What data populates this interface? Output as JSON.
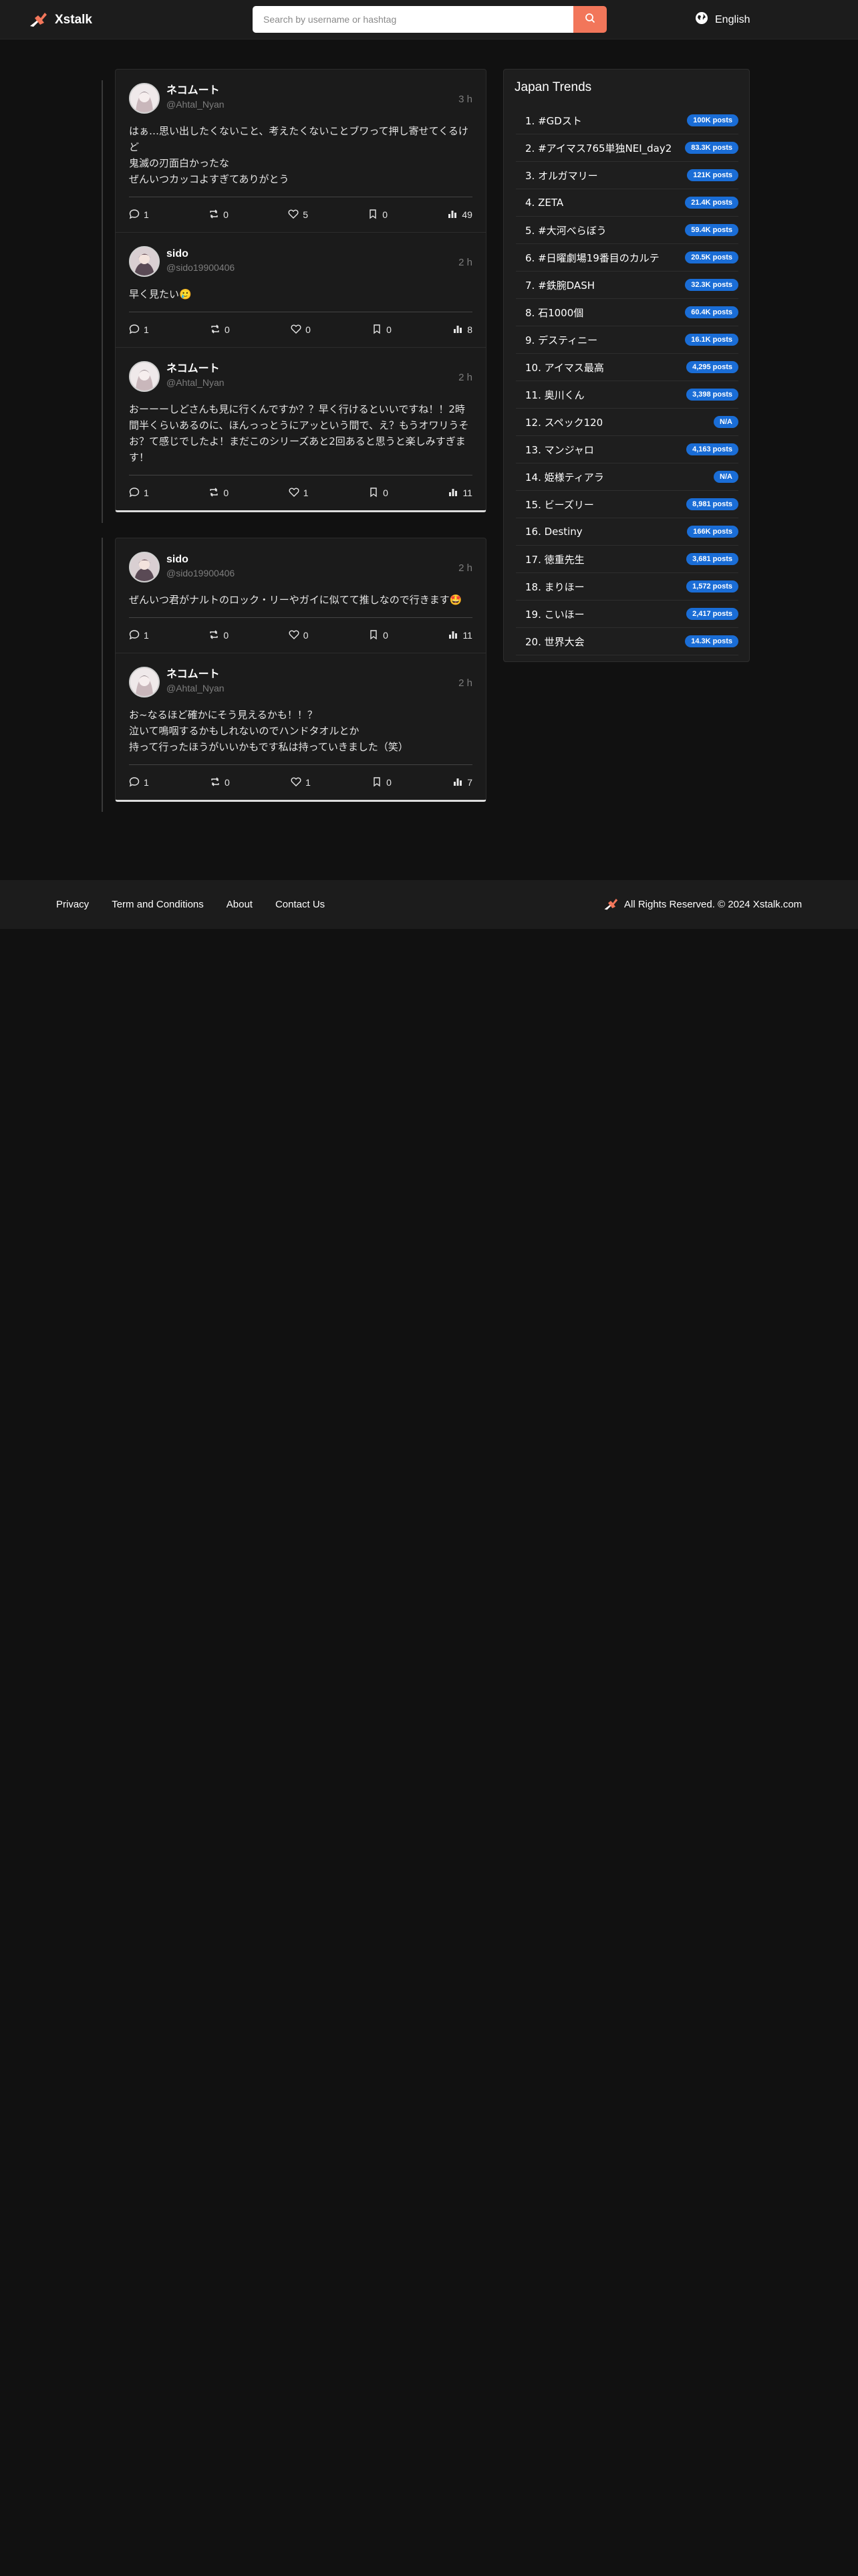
{
  "header": {
    "brand": "Xstalk",
    "search_placeholder": "Search by username or hashtag",
    "language": "English"
  },
  "threads": [
    {
      "posts": [
        {
          "name": "ネコムート",
          "handle": "@Ahtal_Nyan",
          "time": "3 h",
          "text": "はぁ…思い出したくないこと、考えたくないことブワって押し寄せてくるけど\n鬼滅の刃面白かったな\nぜんいつカッコよすぎてありがとう",
          "replies": "1",
          "reposts": "0",
          "likes": "5",
          "bookmarks": "0",
          "views": "49"
        },
        {
          "name": "sido",
          "handle": "@sido19900406",
          "time": "2 h",
          "text": "早く見たい🥲",
          "replies": "1",
          "reposts": "0",
          "likes": "0",
          "bookmarks": "0",
          "views": "8"
        },
        {
          "name": "ネコムート",
          "handle": "@Ahtal_Nyan",
          "time": "2 h",
          "text": "おーーーしどさんも見に行くんですか？？早く行けるといいですね！！2時間半くらいあるのに、ほんっっとうにアッという間で、え？もうオワリうそお？て感じでしたよ！まだこのシリーズあと2回あると思うと楽しみすぎます！",
          "replies": "1",
          "reposts": "0",
          "likes": "1",
          "bookmarks": "0",
          "views": "11"
        }
      ]
    },
    {
      "posts": [
        {
          "name": "sido",
          "handle": "@sido19900406",
          "time": "2 h",
          "text": "ぜんいつ君がナルトのロック・リーやガイに似てて推しなので行きます🤩",
          "replies": "1",
          "reposts": "0",
          "likes": "0",
          "bookmarks": "0",
          "views": "11"
        },
        {
          "name": "ネコムート",
          "handle": "@Ahtal_Nyan",
          "time": "2 h",
          "text": "お~なるほど確かにそう見えるかも！！？\n泣いて鳴咽するかもしれないのでハンドタオルとか\n持って行ったほうがいいかもです私は持っていきました（笑）",
          "replies": "1",
          "reposts": "0",
          "likes": "1",
          "bookmarks": "0",
          "views": "7"
        }
      ]
    }
  ],
  "trends": {
    "title": "Japan Trends",
    "items": [
      {
        "label": "1. #GDスト",
        "count": "100K posts"
      },
      {
        "label": "2. #アイマス765単独NEI_day2",
        "count": "83.3K posts"
      },
      {
        "label": "3. オルガマリー",
        "count": "121K posts"
      },
      {
        "label": "4. ZETA",
        "count": "21.4K posts"
      },
      {
        "label": "5. #大河べらぼう",
        "count": "59.4K posts"
      },
      {
        "label": "6. #日曜劇場19番目のカルテ",
        "count": "20.5K posts"
      },
      {
        "label": "7. #鉄腕DASH",
        "count": "32.3K posts"
      },
      {
        "label": "8. 石1000個",
        "count": "60.4K posts"
      },
      {
        "label": "9. デスティニー",
        "count": "16.1K posts"
      },
      {
        "label": "10. アイマス最高",
        "count": "4,295 posts"
      },
      {
        "label": "11. 奥川くん",
        "count": "3,398 posts"
      },
      {
        "label": "12. スペック120",
        "count": "N/A"
      },
      {
        "label": "13. マンジャロ",
        "count": "4,163 posts"
      },
      {
        "label": "14. 姫様ティアラ",
        "count": "N/A"
      },
      {
        "label": "15. ビーズリー",
        "count": "8,981 posts"
      },
      {
        "label": "16. Destiny",
        "count": "166K posts"
      },
      {
        "label": "17. 徳重先生",
        "count": "3,681 posts"
      },
      {
        "label": "18. まりほー",
        "count": "1,572 posts"
      },
      {
        "label": "19. こいほー",
        "count": "2,417 posts"
      },
      {
        "label": "20. 世界大会",
        "count": "14.3K posts"
      }
    ]
  },
  "footer": {
    "links": [
      "Privacy",
      "Term and Conditions",
      "About",
      "Contact Us"
    ],
    "copyright": "All Rights Reserved. © 2024 Xstalk.com"
  },
  "colors": {
    "background": "#111111",
    "panel": "#1b1b1b",
    "accent": "#f2765a",
    "badge": "#1a6dd6"
  },
  "icons": [
    "xstalk-logo-icon",
    "search-icon",
    "globe-icon",
    "reply-icon",
    "repost-icon",
    "like-icon",
    "bookmark-icon",
    "views-icon"
  ]
}
